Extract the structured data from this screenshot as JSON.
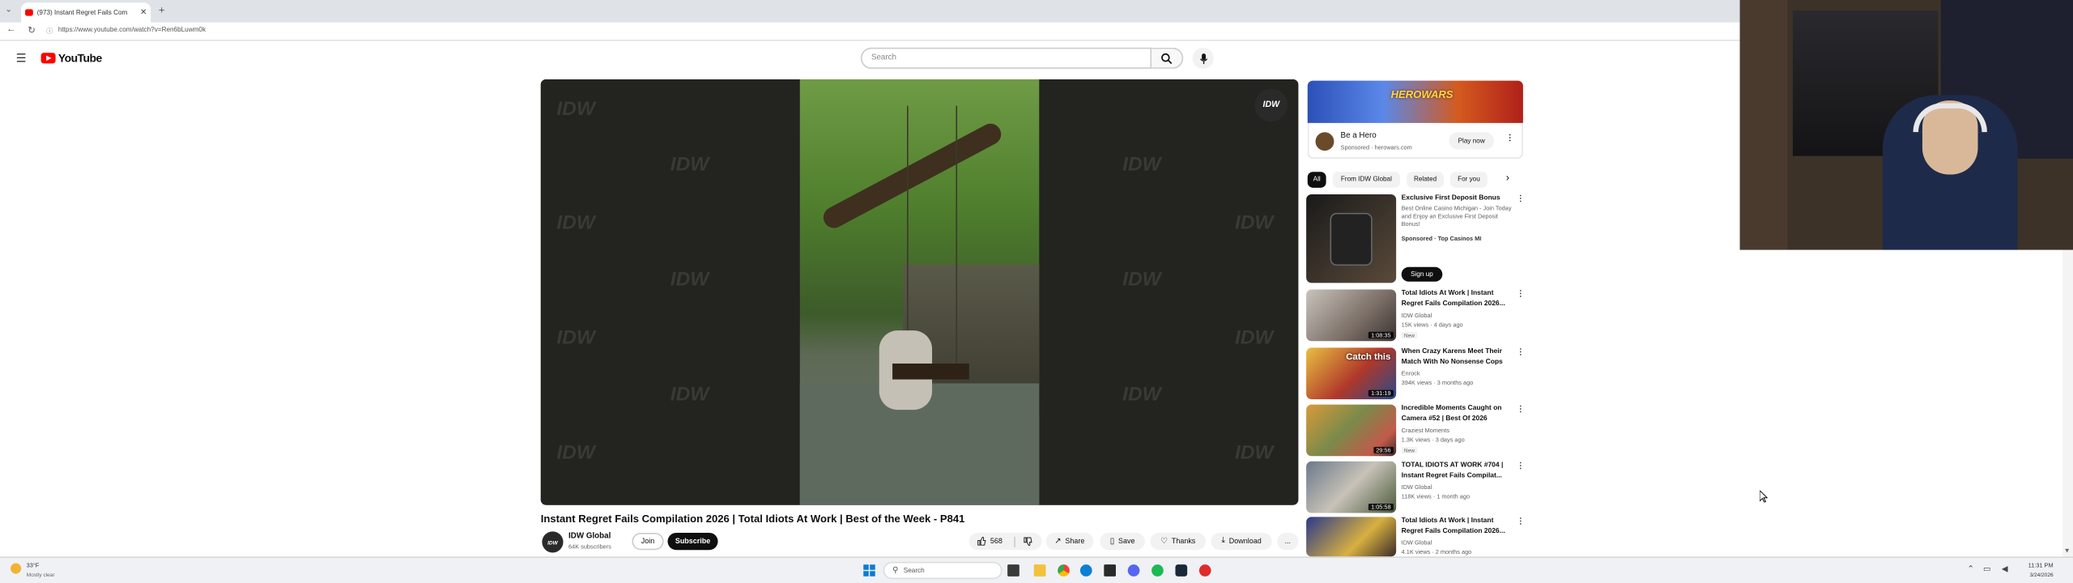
{
  "browser": {
    "tab_title": "(973) Instant Regret Fails Com",
    "url": "https://www.youtube.com/watch?v=Ren6bLuwm0k"
  },
  "header": {
    "logo_text": "YouTube",
    "search_placeholder": "Search"
  },
  "video": {
    "title": "Instant Regret Fails Compilation 2026 | Total Idiots At Work | Best of the Week - P841",
    "watermark_text": "IDW",
    "channel_badge": "IDW"
  },
  "channel": {
    "name": "IDW Global",
    "subscribers": "64K subscribers",
    "avatar_text": "IDW",
    "join_label": "Join",
    "subscribe_label": "Subscribe"
  },
  "actions": {
    "likes": "568",
    "share": "Share",
    "save": "Save",
    "thanks": "Thanks",
    "download": "Download",
    "more": "..."
  },
  "ad": {
    "banner_logo": "HEROWARS",
    "title": "Be a Hero",
    "sponsored": "Sponsored · herowars.com",
    "cta": "Play now"
  },
  "chips": [
    "All",
    "From IDW Global",
    "Related",
    "For you"
  ],
  "recommendations": [
    {
      "title": "Exclusive First Deposit Bonus",
      "meta": "Best Online Casino Michigan - Join Today and Enjoy an Exclusive First Deposit Bonus!",
      "channel": "Sponsored · Top Casinos MI",
      "cta": "Sign up"
    },
    {
      "title": "Total Idiots At Work | Instant Regret Fails Compilation 2026...",
      "channel": "IDW Global",
      "meta": "15K views · 4 days ago",
      "badge": "New",
      "duration": "1:08:35"
    },
    {
      "title": "When Crazy Karens Meet Their Match With No Nonsense Cops",
      "channel": "Enrock",
      "meta": "394K views · 3 months ago",
      "duration": "1:31:19",
      "thumb_text": "Catch this"
    },
    {
      "title": "Incredible Moments Caught on Camera #52 | Best Of 2026",
      "channel": "Craziest Moments",
      "meta": "1.3K views · 3 days ago",
      "badge": "New",
      "duration": "29:56"
    },
    {
      "title": "TOTAL IDIOTS AT WORK #704 | Instant Regret Fails Compilat...",
      "channel": "IDW Global",
      "meta": "118K views · 1 month ago",
      "duration": "1:05:58"
    },
    {
      "title": "Total Idiots At Work | Instant Regret Fails Compilation 2026...",
      "channel": "IDW Global",
      "meta": "4.1K views · 2 months ago"
    }
  ],
  "taskbar": {
    "weather_temp": "33°F",
    "weather_text": "Mostly clear",
    "search": "Search",
    "time": "11:31 PM",
    "date": "3/24/2026"
  }
}
